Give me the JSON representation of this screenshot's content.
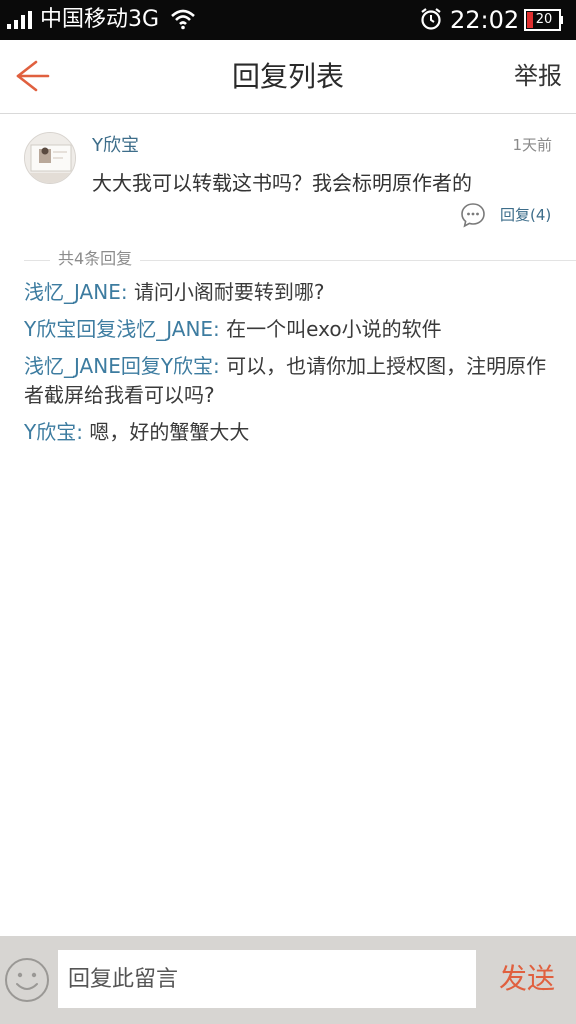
{
  "status_bar": {
    "carrier": "中国移动3G",
    "time": "22:02",
    "battery": "20"
  },
  "header": {
    "title": "回复列表",
    "report_label": "举报"
  },
  "post": {
    "author": "Y欣宝",
    "time": "1天前",
    "content": "大大我可以转载这书吗？我会标明原作者的",
    "reply_count_label": "回复(4)"
  },
  "replies_header": {
    "label": "共4条回复"
  },
  "replies": [
    {
      "from": "浅忆_JANE",
      "reply_word": "",
      "to": "",
      "text": "请问小阁耐要转到哪?"
    },
    {
      "from": "Y欣宝",
      "reply_word": "回复",
      "to": "浅忆_JANE",
      "text": "在一个叫exo小说的软件"
    },
    {
      "from": "浅忆_JANE",
      "reply_word": "回复",
      "to": "Y欣宝",
      "text": "可以，也请你加上授权图，注明原作者截屏给我看可以吗?"
    },
    {
      "from": "Y欣宝",
      "reply_word": "",
      "to": "",
      "text": "嗯，好的蟹蟹大大"
    }
  ],
  "input_bar": {
    "placeholder": "回复此留言",
    "send_label": "发送"
  },
  "colors": {
    "accent": "#e0603f",
    "link": "#3d7ca0",
    "status_bar_bg": "#0a0a0a",
    "input_bar_bg": "#d7d5d2"
  },
  "icons": {
    "back": "arrow-left-icon",
    "comment": "comment-bubble-icon",
    "emoji": "smiley-face-icon",
    "wifi": "wifi-icon",
    "alarm": "alarm-clock-icon",
    "signal": "signal-bars-icon",
    "battery": "battery-icon"
  }
}
